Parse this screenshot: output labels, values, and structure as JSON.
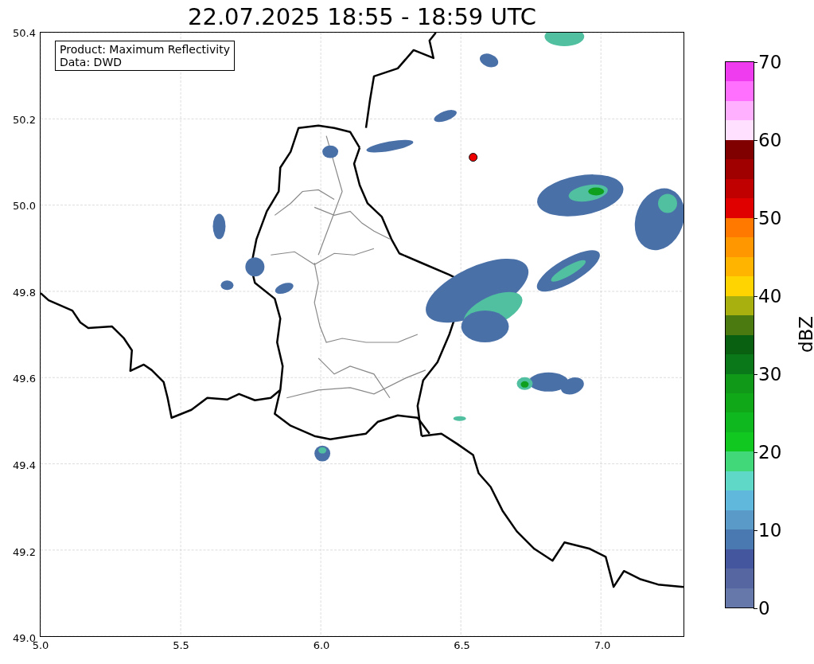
{
  "title": "22.07.2025 18:55 - 18:59 UTC",
  "info_box": {
    "lines": [
      "Product: Maximum Reflectivity",
      "Data: DWD"
    ]
  },
  "axes": {
    "x_ticks": [
      "5.0",
      "5.5",
      "6.0",
      "6.5",
      "7.0"
    ],
    "y_ticks": [
      "50.4",
      "50.2",
      "50.0",
      "49.8",
      "49.6",
      "49.4",
      "49.2",
      "49.0"
    ]
  },
  "colorbar": {
    "label": "dBZ",
    "ticks": [
      "70",
      "60",
      "50",
      "40",
      "30",
      "20",
      "10",
      "0"
    ],
    "bands": [
      {
        "color": "#ee3cee"
      },
      {
        "color": "#ff70ff"
      },
      {
        "color": "#ffb0ff"
      },
      {
        "color": "#ffe0ff"
      },
      {
        "color": "#800000"
      },
      {
        "color": "#a00000"
      },
      {
        "color": "#c00000"
      },
      {
        "color": "#e00000"
      },
      {
        "color": "#ff7800"
      },
      {
        "color": "#ff9800"
      },
      {
        "color": "#ffb400"
      },
      {
        "color": "#ffd400"
      },
      {
        "color": "#a8b010"
      },
      {
        "color": "#4a7a10"
      },
      {
        "color": "#086010"
      },
      {
        "color": "#0a7818"
      },
      {
        "color": "#109818"
      },
      {
        "color": "#10a818"
      },
      {
        "color": "#10b820"
      },
      {
        "color": "#10c820"
      },
      {
        "color": "#40d878"
      },
      {
        "color": "#60d8c8"
      },
      {
        "color": "#60b8dc"
      },
      {
        "color": "#5a9ac8"
      },
      {
        "color": "#4a78b0"
      },
      {
        "color": "#44579e"
      },
      {
        "color": "#5566a0"
      },
      {
        "color": "#6677aa"
      }
    ]
  }
}
